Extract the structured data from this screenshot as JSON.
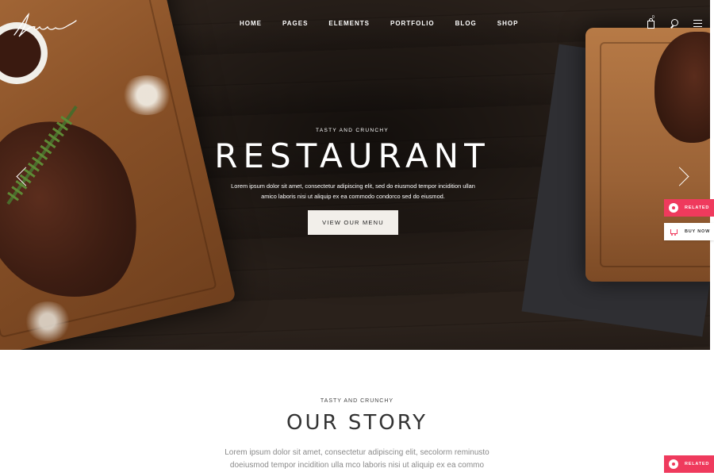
{
  "logo": {
    "text": "Lumin"
  },
  "nav": {
    "items": [
      "HOME",
      "PAGES",
      "ELEMENTS",
      "PORTFOLIO",
      "BLOG",
      "SHOP"
    ],
    "cart_count": "0"
  },
  "hero": {
    "subtitle": "TASTY AND CRUNCHY",
    "title": "RESTAURANT",
    "text_line1": "Lorem ipsum dolor sit amet, consectetur adipiscing elit, sed do eiusmod tempor incidition ullan",
    "text_line2": "amico laboris nisi ut aliquip ex ea commodo condorco sed do eiusmod.",
    "button_label": "VIEW OUR MENU"
  },
  "side_badges": {
    "related_label": "RELATED",
    "buy_label": "BUY NOW",
    "related_bottom_label": "RELATED"
  },
  "story": {
    "subtitle": "TASTY AND CRUNCHY",
    "title": "OUR STORY",
    "text_line1": "Lorem ipsum dolor sit amet, consectetur adipiscing elit, secolorm reminusto",
    "text_line2": "doeiusmod tempor incidition ulla mco laboris nisi ut aliquip ex ea commo"
  },
  "colors": {
    "accent": "#ef3a5d",
    "hero_button_bg": "#f2efea",
    "text_dark": "#333333",
    "text_muted": "#8a8a8a"
  }
}
